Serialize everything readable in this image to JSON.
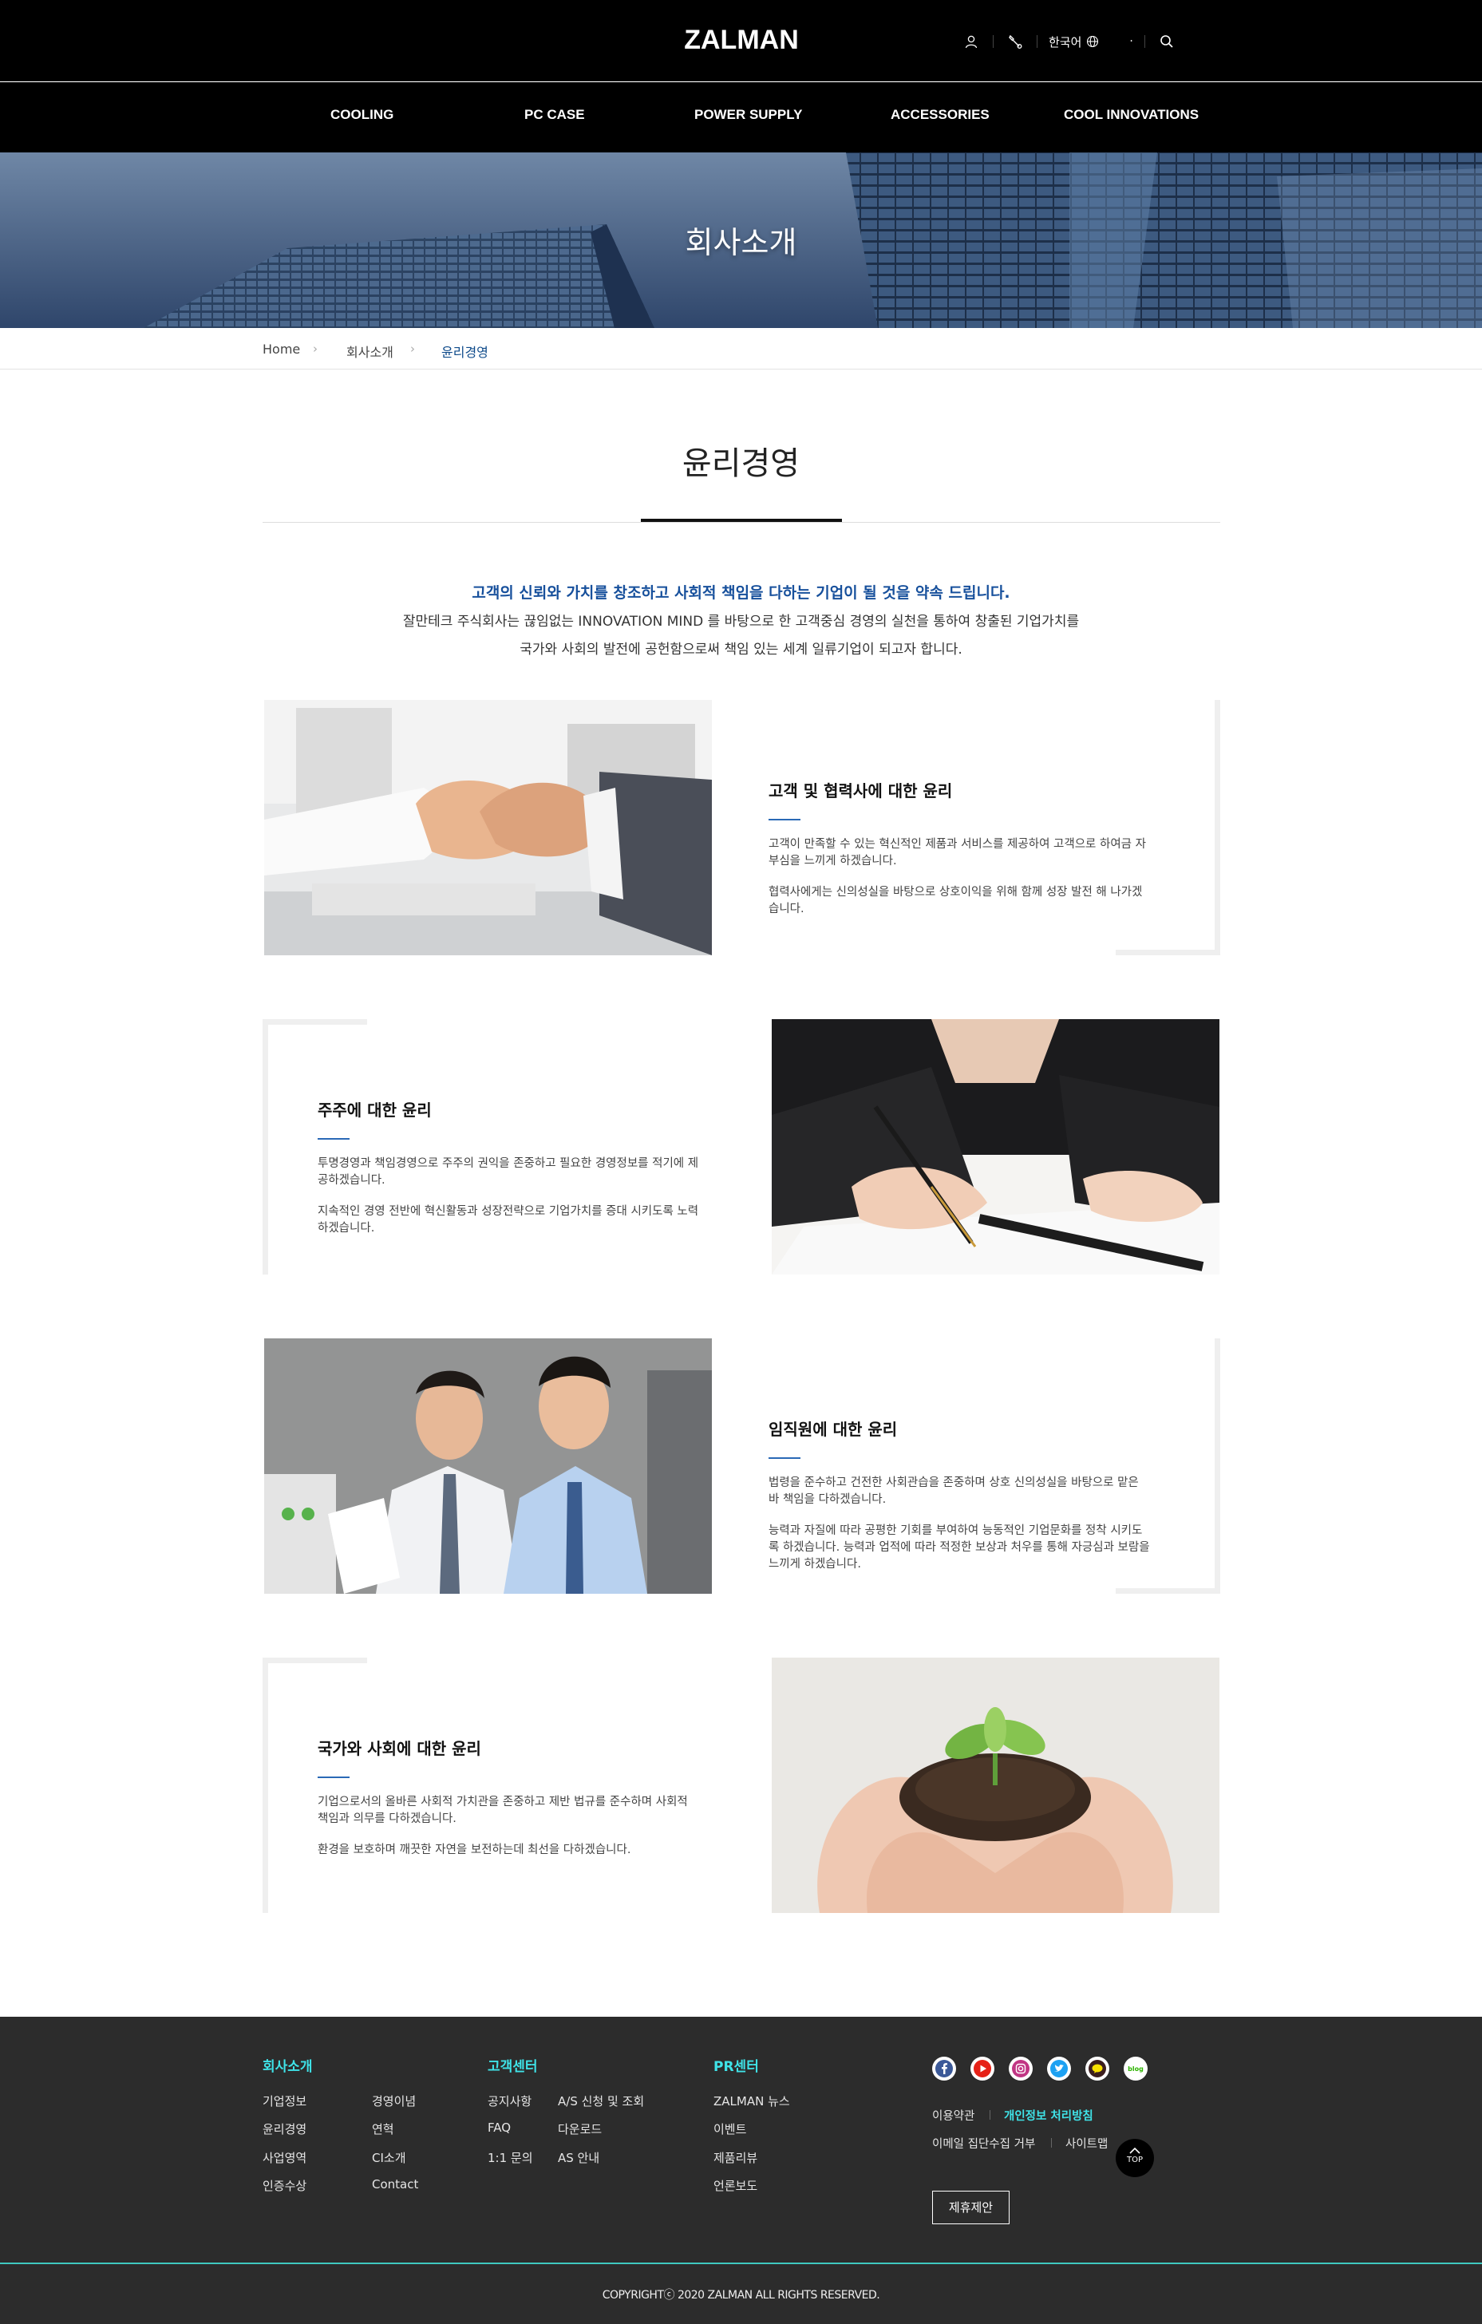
{
  "header": {
    "logo": "ZALMAN",
    "language": "한국어",
    "dot": "·"
  },
  "nav": {
    "items": [
      "COOLING",
      "PC CASE",
      "POWER SUPPLY",
      "ACCESSORIES",
      "COOL INNOVATIONS"
    ]
  },
  "visual": {
    "title": "회사소개"
  },
  "breadcrumb": {
    "home": "Home",
    "level1": "회사소개",
    "current": "윤리경영",
    "separator": "›"
  },
  "page": {
    "title": "윤리경영",
    "intro_head": "고객의 신뢰와 가치를 창조하고 사회적 책임을 다하는 기업이 될 것을 약속 드립니다.",
    "intro_line1": "잘만테크 주식회사는 끊임없는 INNOVATION MIND 를 바탕으로 한 고객중심 경영의 실천을 통하여 창출된 기업가치를",
    "intro_line2": "국가와 사회의 발전에 공헌함으로써 책임 있는 세계 일류기업이 되고자 합니다."
  },
  "blocks": [
    {
      "title": "고객 및 협력사에 대한 윤리",
      "p1": "고객이 만족할 수 있는 혁신적인 제품과 서비스를 제공하여 고객으로 하여금 자부심을 느끼게 하겠습니다.",
      "p2": "협력사에게는 신의성실을 바탕으로 상호이익을 위해 함께 성장 발전 해 나가겠습니다."
    },
    {
      "title": "주주에 대한 윤리",
      "p1": "투명경영과 책임경영으로 주주의 권익을 존중하고 필요한 경영정보를 적기에 제공하겠습니다.",
      "p2": "지속적인 경영 전반에 혁신활동과 성장전략으로 기업가치를 증대 시키도록 노력하겠습니다."
    },
    {
      "title": "임직원에 대한 윤리",
      "p1": "법령을 준수하고 건전한 사회관습을 존중하며 상호 신의성실을 바탕으로 맡은 바 책임을 다하겠습니다.",
      "p2": "능력과 자질에 따라 공평한 기회를 부여하여 능동적인 기업문화를 정착 시키도록 하겠습니다. 능력과 업적에 따라 적정한 보상과 처우를 통해 자긍심과 보람을 느끼게 하겠습니다."
    },
    {
      "title": "국가와 사회에 대한 윤리",
      "p1": "기업으로서의 올바른 사회적 가치관을 존중하고 제반 법규를 준수하며 사회적 책임과 의무를 다하겠습니다.",
      "p2": "환경을 보호하며 깨끗한 자연을 보전하는데 최선을 다하겠습니다."
    }
  ],
  "footer": {
    "company": {
      "heading": "회사소개",
      "col1": [
        "기업정보",
        "윤리경영",
        "사업영역",
        "인증수상"
      ],
      "col2": [
        "경영이념",
        "연혁",
        "CI소개",
        "Contact"
      ]
    },
    "support": {
      "heading": "고객센터",
      "col1": [
        "공지사항",
        "FAQ",
        "1:1 문의"
      ],
      "col2": [
        "A/S 신청 및 조회",
        "다운로드",
        "AS 안내"
      ]
    },
    "pr": {
      "heading": "PR센터",
      "col1": [
        "ZALMAN 뉴스",
        "이벤트",
        "제품리뷰",
        "언론보도"
      ]
    },
    "sns": [
      "facebook-icon",
      "youtube-icon",
      "instagram-icon",
      "twitter-icon",
      "kakaotalk-icon",
      "blog-icon"
    ],
    "blog_label": "blog",
    "policy": {
      "terms": "이용약관",
      "privacy": "개인정보 처리방침",
      "email": "이메일 집단수집 거부",
      "sitemap": "사이트맵"
    },
    "top_label": "TOP",
    "suggest_label": "제휴제안",
    "copyright": "COPYRIGHTⓒ 2020 ZALMAN ALL RIGHTS RESERVED."
  },
  "colors": {
    "accent_blue": "#17509c",
    "footer_cyan": "#3fe3e8",
    "footer_bg": "#2c2c2c"
  }
}
